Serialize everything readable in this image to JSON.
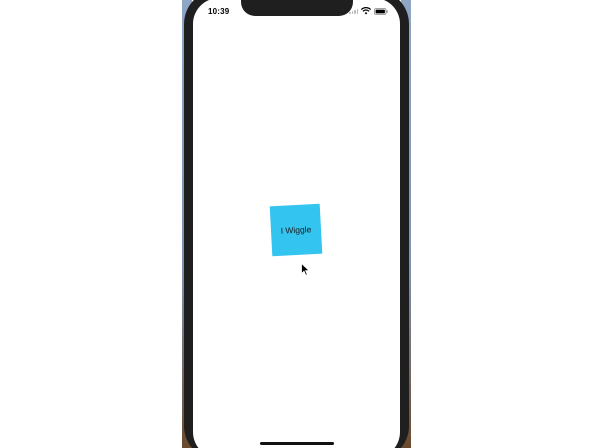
{
  "status_bar": {
    "time": "10:39",
    "icons": [
      "cellular-signal-icon",
      "wifi-icon",
      "battery-icon"
    ]
  },
  "main": {
    "wiggle_button_label": "I Wiggle",
    "wiggle_button_color": "#33c4f0"
  },
  "device": {
    "frame_color": "#1f1f1f",
    "screen_color": "#ffffff"
  }
}
